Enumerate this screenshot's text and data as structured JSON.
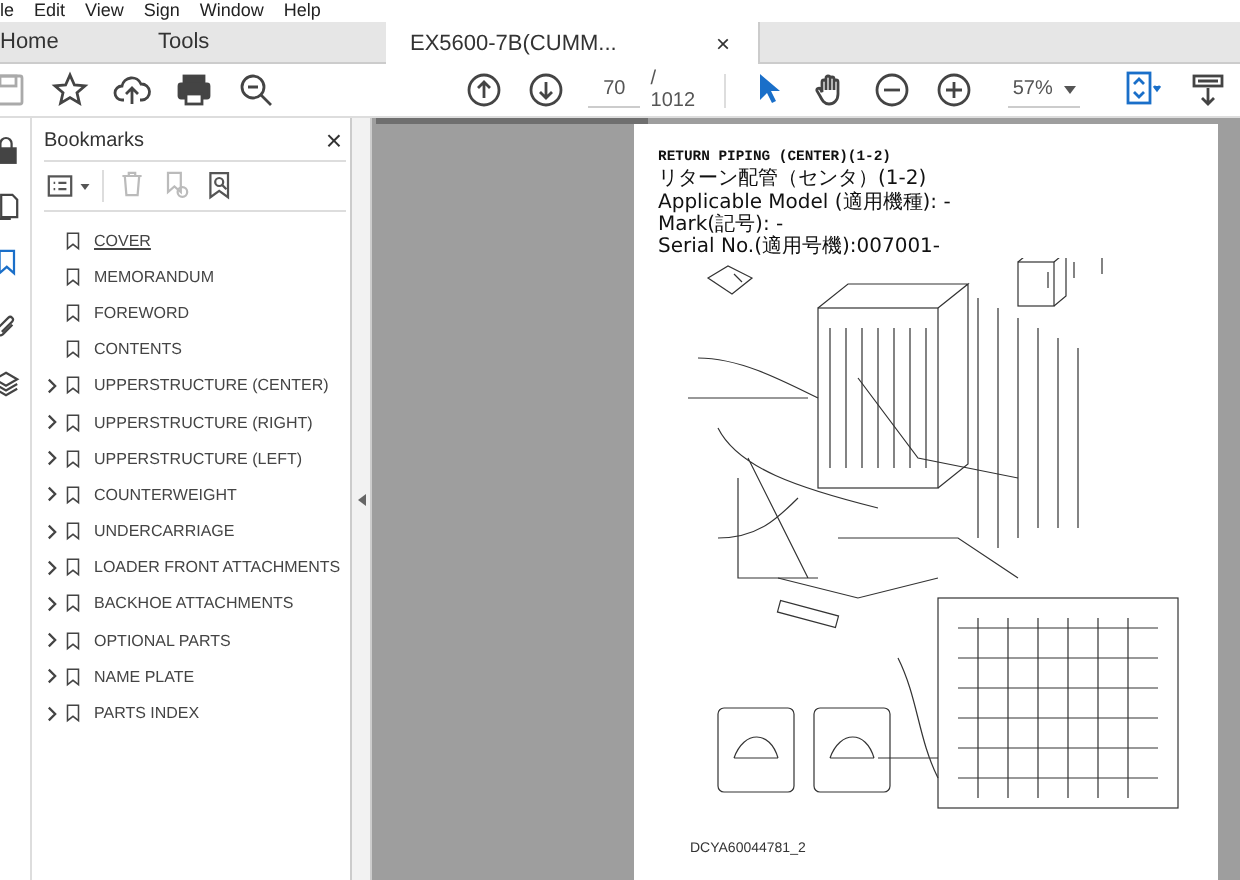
{
  "menu_bar": [
    "le",
    "Edit",
    "View",
    "Sign",
    "Window",
    "Help"
  ],
  "tabs": [
    {
      "label": "Home",
      "selected": false,
      "kind": "nav"
    },
    {
      "label": "Tools",
      "selected": false,
      "kind": "nav"
    },
    {
      "label": "EX5600-7B(CUMM...",
      "selected": true,
      "kind": "document",
      "close": "×"
    }
  ],
  "toolbar": {
    "page": "70",
    "page_total": "/ 1012",
    "zoom": "57%"
  },
  "bookmarks": {
    "title": "Bookmarks",
    "close": "×",
    "items": [
      {
        "label": "COVER",
        "selected": true,
        "expandable": false
      },
      {
        "label": "MEMORANDUM",
        "selected": false,
        "expandable": false
      },
      {
        "label": "FOREWORD",
        "selected": false,
        "expandable": false
      },
      {
        "label": "CONTENTS",
        "selected": false,
        "expandable": false
      },
      {
        "label": "UPPERSTRUCTURE (CENTER)",
        "selected": false,
        "expandable": true
      },
      {
        "label": "UPPERSTRUCTURE (RIGHT)",
        "selected": false,
        "expandable": true
      },
      {
        "label": "UPPERSTRUCTURE (LEFT)",
        "selected": false,
        "expandable": true
      },
      {
        "label": "COUNTERWEIGHT",
        "selected": false,
        "expandable": true
      },
      {
        "label": "UNDERCARRIAGE",
        "selected": false,
        "expandable": true
      },
      {
        "label": "LOADER FRONT ATTACHMENTS",
        "selected": false,
        "expandable": true
      },
      {
        "label": "BACKHOE ATTACHMENTS",
        "selected": false,
        "expandable": true
      },
      {
        "label": "OPTIONAL PARTS",
        "selected": false,
        "expandable": true
      },
      {
        "label": "NAME PLATE",
        "selected": false,
        "expandable": true
      },
      {
        "label": "PARTS INDEX",
        "selected": false,
        "expandable": true
      }
    ]
  },
  "page": {
    "title": "RETURN PIPING (CENTER)(1-2)",
    "title_jp": "リターン配管（センタ）(1-2)",
    "info": [
      "Applicable Model (適用機種): -",
      "Mark(記号): -",
      "Serial No.(適用号機):007001-"
    ],
    "caption": "DCYA60044781_2"
  }
}
